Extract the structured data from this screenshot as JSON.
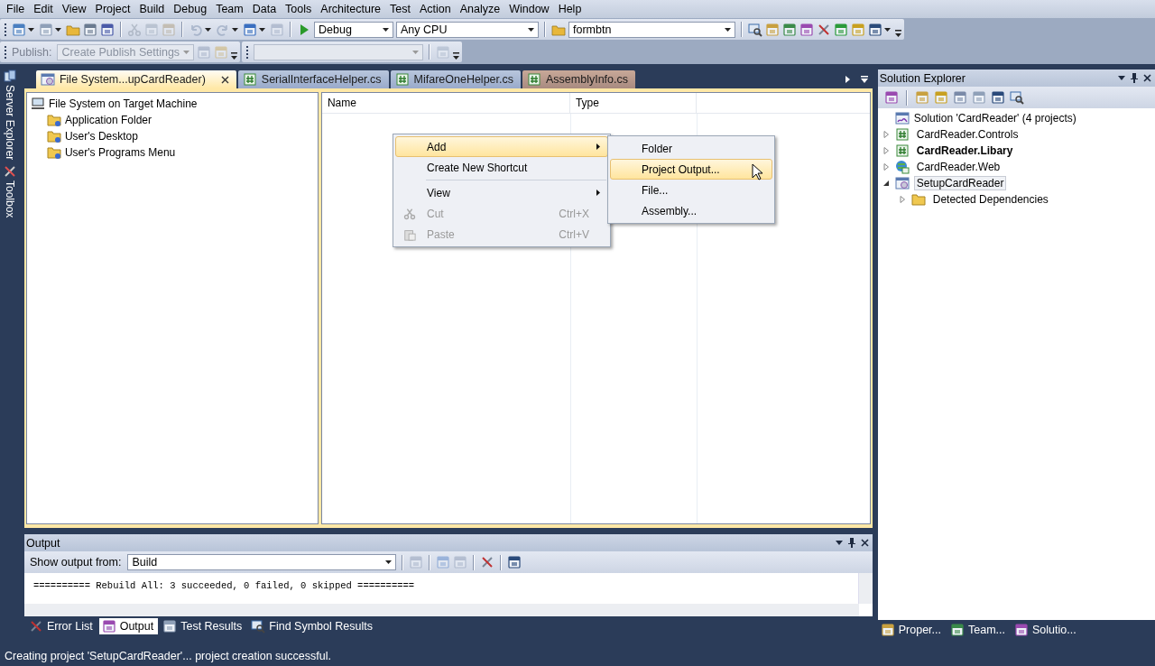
{
  "menu_bar": [
    "File",
    "Edit",
    "View",
    "Project",
    "Build",
    "Debug",
    "Team",
    "Data",
    "Tools",
    "Architecture",
    "Test",
    "Action",
    "Analyze",
    "Window",
    "Help"
  ],
  "toolbar": {
    "configuration": "Debug",
    "platform": "Any CPU",
    "find": "formbtn"
  },
  "publish_toolbar": {
    "label": "Publish:",
    "settings": "Create Publish Settings",
    "disabled": true
  },
  "side_tabs": [
    "Server Explorer",
    "Toolbox"
  ],
  "document_tabs": [
    {
      "label": "File System...upCardReader)",
      "kind": "setup",
      "selected": true,
      "hovered": false
    },
    {
      "label": "SerialInterfaceHelper.cs",
      "kind": "csharp",
      "selected": false,
      "hovered": false
    },
    {
      "label": "MifareOneHelper.cs",
      "kind": "csharp",
      "selected": false,
      "hovered": false
    },
    {
      "label": "AssemblyInfo.cs",
      "kind": "csharp",
      "selected": false,
      "hovered": true
    }
  ],
  "file_system_tree": {
    "label": "File System on Target Machine",
    "children": [
      {
        "label": "Application Folder"
      },
      {
        "label": "User's Desktop"
      },
      {
        "label": "User's Programs Menu"
      }
    ]
  },
  "list_columns": [
    "Name",
    "Type"
  ],
  "context_menu": [
    {
      "kind": "item",
      "label": "Add",
      "has_submenu": true,
      "selected": true,
      "disabled": false
    },
    {
      "kind": "item",
      "label": "Create New Shortcut",
      "has_submenu": false,
      "selected": false,
      "disabled": false
    },
    {
      "kind": "separator"
    },
    {
      "kind": "item",
      "label": "View",
      "has_submenu": true,
      "selected": false,
      "disabled": false
    },
    {
      "kind": "item",
      "label": "Cut",
      "shortcut": "Ctrl+X",
      "has_submenu": false,
      "selected": false,
      "disabled": true
    },
    {
      "kind": "item",
      "label": "Paste",
      "shortcut": "Ctrl+V",
      "has_submenu": false,
      "selected": false,
      "disabled": true
    }
  ],
  "submenu": [
    {
      "label": "Folder",
      "selected": false
    },
    {
      "label": "Project Output...",
      "selected": true
    },
    {
      "label": "File...",
      "selected": false
    },
    {
      "label": "Assembly...",
      "selected": false
    }
  ],
  "output": {
    "title": "Output",
    "source_label": "Show output from:",
    "source": "Build",
    "lines": [
      "========== Rebuild All: 3 succeeded, 0 failed, 0 skipped =========="
    ]
  },
  "bottom_tabs": [
    {
      "label": "Error List",
      "selected": false
    },
    {
      "label": "Output",
      "selected": true
    },
    {
      "label": "Test Results",
      "selected": false
    },
    {
      "label": "Find Symbol Results",
      "selected": false
    }
  ],
  "solution_explorer": {
    "title": "Solution Explorer",
    "root": "Solution 'CardReader' (4 projects)",
    "items": [
      {
        "label": "CardReader.Controls",
        "kind": "csharp",
        "bold": false,
        "expanded": false,
        "selected": false
      },
      {
        "label": "CardReader.Libary",
        "kind": "csharp",
        "bold": true,
        "expanded": false,
        "selected": false
      },
      {
        "label": "CardReader.Web",
        "kind": "web",
        "bold": false,
        "expanded": false,
        "selected": false
      },
      {
        "label": "SetupCardReader",
        "kind": "setup",
        "bold": false,
        "expanded": true,
        "selected": true,
        "children": [
          {
            "label": "Detected Dependencies",
            "kind": "folder",
            "bold": false,
            "expanded": false,
            "selected": false
          }
        ]
      }
    ]
  },
  "right_bottom_tabs": [
    {
      "label": "Proper..."
    },
    {
      "label": "Team..."
    },
    {
      "label": "Solutio..."
    }
  ],
  "status_bar": "Creating project 'SetupCardReader'... project creation successful."
}
